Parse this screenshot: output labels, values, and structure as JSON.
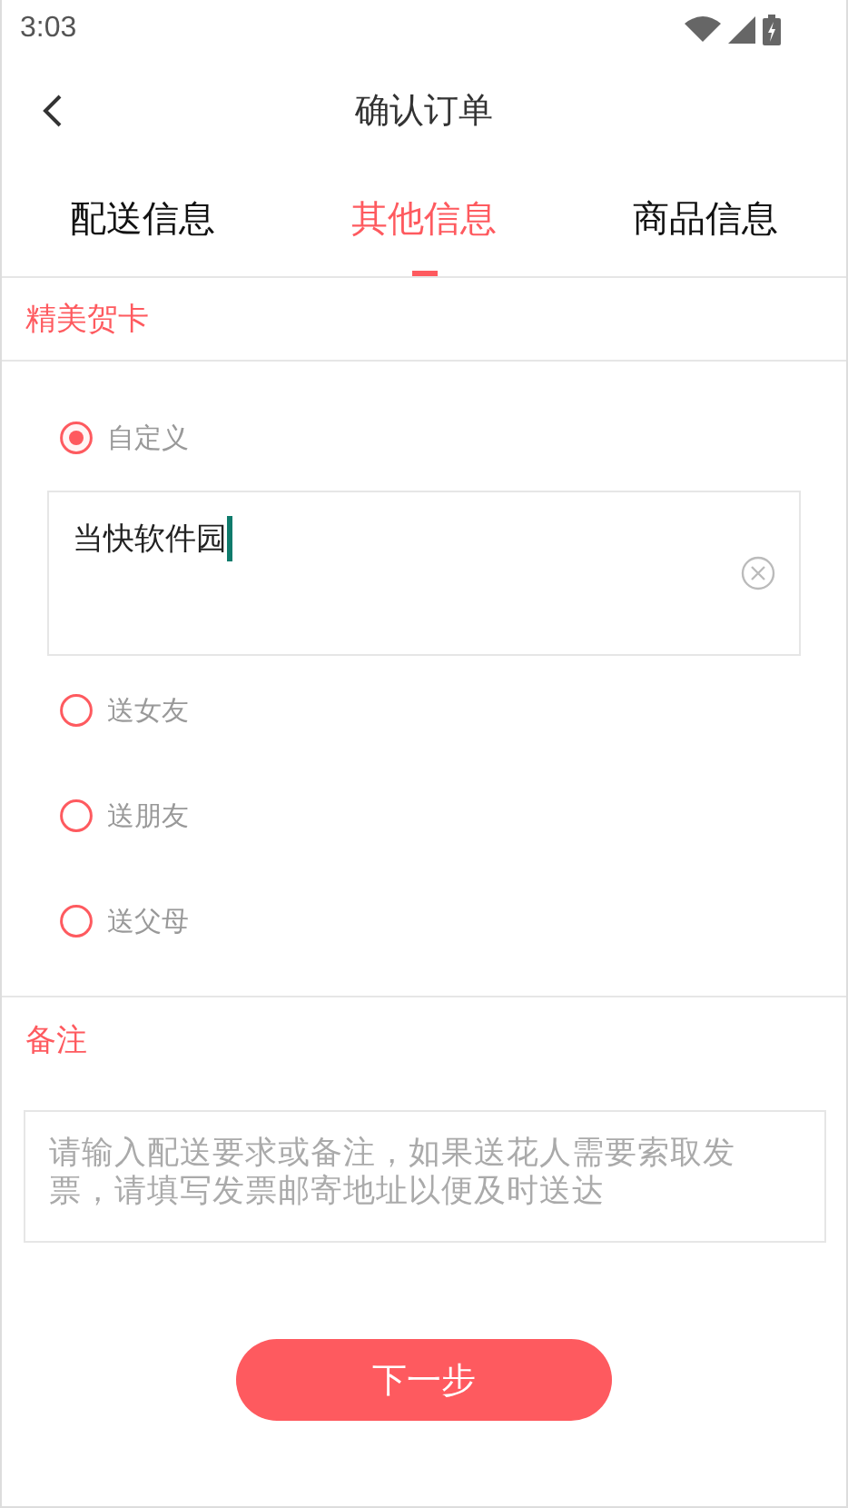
{
  "status_bar": {
    "time": "3:03"
  },
  "header": {
    "title": "确认订单"
  },
  "tabs": [
    {
      "label": "配送信息",
      "selected": false
    },
    {
      "label": "其他信息",
      "selected": true
    },
    {
      "label": "商品信息",
      "selected": false
    }
  ],
  "gift_card": {
    "heading": "精美贺卡",
    "options": [
      {
        "label": "自定义",
        "selected": true,
        "custom_text": "当快软件园"
      },
      {
        "label": "送女友",
        "selected": false
      },
      {
        "label": "送朋友",
        "selected": false
      },
      {
        "label": "送父母",
        "selected": false
      }
    ]
  },
  "remarks": {
    "heading": "备注",
    "placeholder": "请输入配送要求或备注，如果送花人需要索取发票，请填写发票邮寄地址以便及时送达"
  },
  "next_button": {
    "label": "下一步"
  }
}
